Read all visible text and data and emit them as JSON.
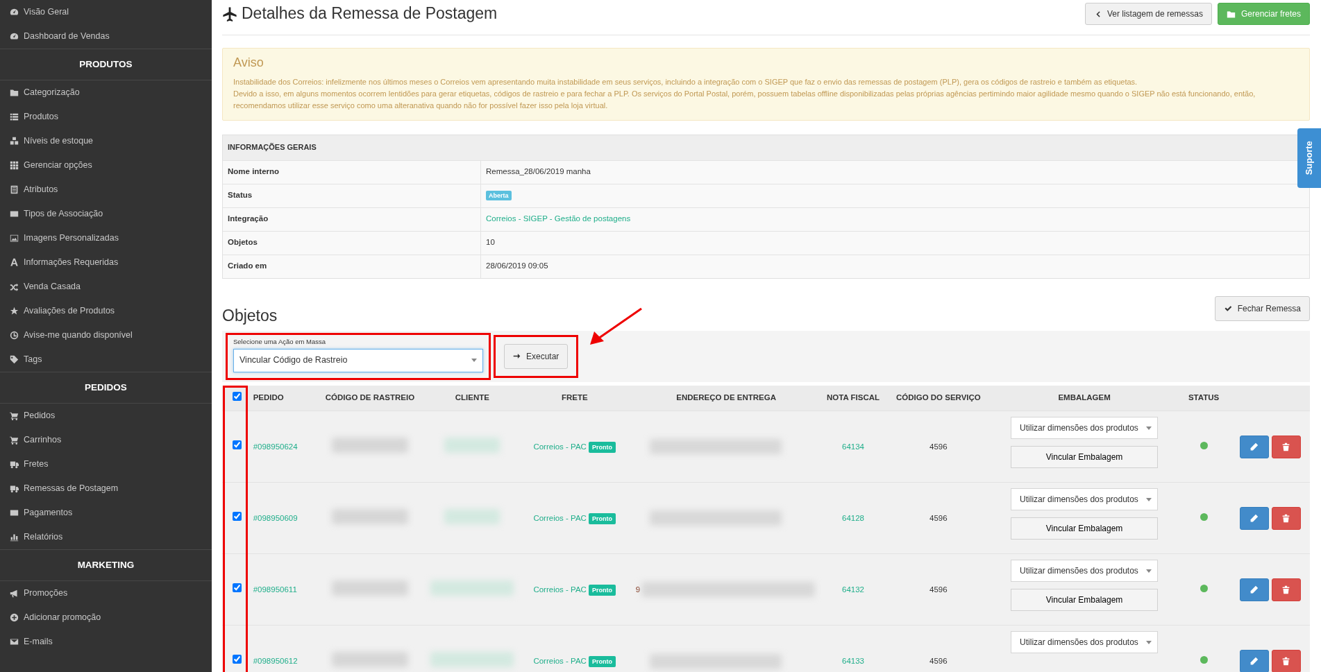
{
  "sidebar": {
    "items": [
      {
        "kind": "link",
        "label": "Visão Geral"
      },
      {
        "kind": "link",
        "label": "Dashboard de Vendas"
      },
      {
        "kind": "heading",
        "label": "PRODUTOS"
      },
      {
        "kind": "link",
        "label": "Categorização"
      },
      {
        "kind": "link",
        "label": "Produtos"
      },
      {
        "kind": "link",
        "label": "Níveis de estoque"
      },
      {
        "kind": "link",
        "label": "Gerenciar opções"
      },
      {
        "kind": "link",
        "label": "Atributos"
      },
      {
        "kind": "link",
        "label": "Tipos de Associação"
      },
      {
        "kind": "link",
        "label": "Imagens Personalizadas"
      },
      {
        "kind": "link",
        "label": "Informações Requeridas"
      },
      {
        "kind": "link",
        "label": "Venda Casada"
      },
      {
        "kind": "link",
        "label": "Avaliações de Produtos"
      },
      {
        "kind": "link",
        "label": "Avise-me quando disponível"
      },
      {
        "kind": "link",
        "label": "Tags"
      },
      {
        "kind": "heading",
        "label": "PEDIDOS"
      },
      {
        "kind": "link",
        "label": "Pedidos"
      },
      {
        "kind": "link",
        "label": "Carrinhos"
      },
      {
        "kind": "link",
        "label": "Fretes"
      },
      {
        "kind": "link",
        "label": "Remessas de Postagem"
      },
      {
        "kind": "link",
        "label": "Pagamentos"
      },
      {
        "kind": "link",
        "label": "Relatórios"
      },
      {
        "kind": "heading",
        "label": "MARKETING"
      },
      {
        "kind": "link",
        "label": "Promoções"
      },
      {
        "kind": "link",
        "label": "Adicionar promoção"
      },
      {
        "kind": "link",
        "label": "E-mails"
      }
    ]
  },
  "page": {
    "title": "Detalhes da Remessa de Postagem",
    "buttons": [
      {
        "kind": "default",
        "label": "Ver listagem de remessas"
      },
      {
        "kind": "success",
        "label": "Gerenciar fretes"
      }
    ]
  },
  "alert": {
    "title": "Aviso",
    "paragraphs": [
      "Instabilidade dos Correios: infelizmente nos últimos meses o Correios vem apresentando muita instabilidade em seus serviços, incluindo a integração com o SIGEP que faz o envio das remessas de postagem (PLP), gera os códigos de rastreio e também as etiquetas.",
      "Devido a isso, em alguns momentos ocorrem lentidões para gerar etiquetas, códigos de rastreio e para fechar a PLP. Os serviços do Portal Postal, porém, possuem tabelas offline disponibilizadas pelas próprias agências pertimindo maior agilidade mesmo quando o SIGEP não está funcionando, então, recomendamos utilizar esse serviço como uma alteranativa quando não for possível fazer isso pela loja virtual."
    ]
  },
  "info": {
    "heading": "INFORMAÇÕES GERAIS",
    "rows": [
      {
        "kind": "text",
        "label": "Nome interno",
        "value": "Remessa_28/06/2019 manha"
      },
      {
        "kind": "badge",
        "label": "Status",
        "value": "Aberta"
      },
      {
        "kind": "link",
        "label": "Integração",
        "value": "Correios - SIGEP - Gestão de postagens"
      },
      {
        "kind": "text",
        "label": "Objetos",
        "value": "10"
      },
      {
        "kind": "text",
        "label": "Criado em",
        "value": "28/06/2019 09:05"
      }
    ]
  },
  "objects": {
    "title": "Objetos",
    "close_button": "Fechar Remessa",
    "bulk": {
      "label": "Selecione uma Ação em Massa",
      "value": "Vincular Código de Rastreio",
      "button": "Executar"
    },
    "select_all_checked": true,
    "columns": [
      "PEDIDO",
      "CÓDIGO DE RASTREIO",
      "CLIENTE",
      "FRETE",
      "ENDEREÇO DE ENTREGA",
      "NOTA FISCAL",
      "CÓDIGO DO SERVIÇO",
      "EMBALAGEM",
      "STATUS"
    ],
    "rows": [
      {
        "checked": true,
        "order": "#098950624",
        "shipping": "Correios - PAC",
        "shipping_badge": "Pronto",
        "invoice": "64134",
        "service_code": "4596",
        "packaging": "Utilizar dimensões dos produtos",
        "pack_button": "Vincular Embalagem",
        "color": "#5cb85c"
      },
      {
        "checked": true,
        "order": "#098950609",
        "shipping": "Correios - PAC",
        "shipping_badge": "Pronto",
        "invoice": "64128",
        "service_code": "4596",
        "packaging": "Utilizar dimensões dos produtos",
        "pack_button": "Vincular Embalagem",
        "color": "#5cb85c"
      },
      {
        "checked": true,
        "order": "#098950611",
        "shipping": "Correios - PAC",
        "shipping_badge": "Pronto",
        "address_fragment": "9",
        "invoice": "64132",
        "service_code": "4596",
        "packaging": "Utilizar dimensões dos produtos",
        "pack_button": "Vincular Embalagem",
        "color": "#5cb85c"
      },
      {
        "checked": true,
        "order": "#098950612",
        "shipping": "Correios - PAC",
        "shipping_badge": "Pronto",
        "invoice": "64133",
        "service_code": "4596",
        "packaging": "Utilizar dimensões dos produtos",
        "color": "#5cb85c"
      }
    ]
  },
  "annotations": {
    "bulk_frame": true,
    "execute_frame": true,
    "checkbox_frame": true,
    "arrow": true
  },
  "support_tab": "Suporte"
}
